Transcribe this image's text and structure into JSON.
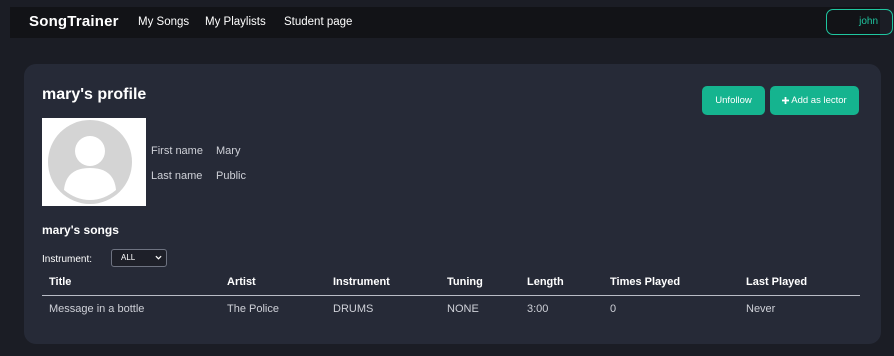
{
  "nav": {
    "brand": "SongTrainer",
    "links": [
      "My Songs",
      "My Playlists",
      "Student page"
    ],
    "user": "john"
  },
  "profile": {
    "title": "mary's profile",
    "unfollow_label": "Unfollow",
    "add_lector_label": "Add as lector",
    "first_name_label": "First name",
    "first_name": "Mary",
    "last_name_label": "Last name",
    "last_name": "Public"
  },
  "songs": {
    "title": "mary's songs",
    "instrument_label": "Instrument:",
    "instrument_selected": "ALL",
    "columns": [
      "Title",
      "Artist",
      "Instrument",
      "Tuning",
      "Length",
      "Times Played",
      "Last Played"
    ],
    "rows": [
      [
        "Message in a bottle",
        "The Police",
        "DRUMS",
        "NONE",
        "3:00",
        "0",
        "Never"
      ]
    ]
  },
  "colors": {
    "accent": "#15b48f",
    "card": "#262a37",
    "navbar": "#121317",
    "background": "#1b1d25"
  },
  "icons": [
    "default-avatar-icon",
    "plus-icon",
    "chevron-down-icon"
  ]
}
